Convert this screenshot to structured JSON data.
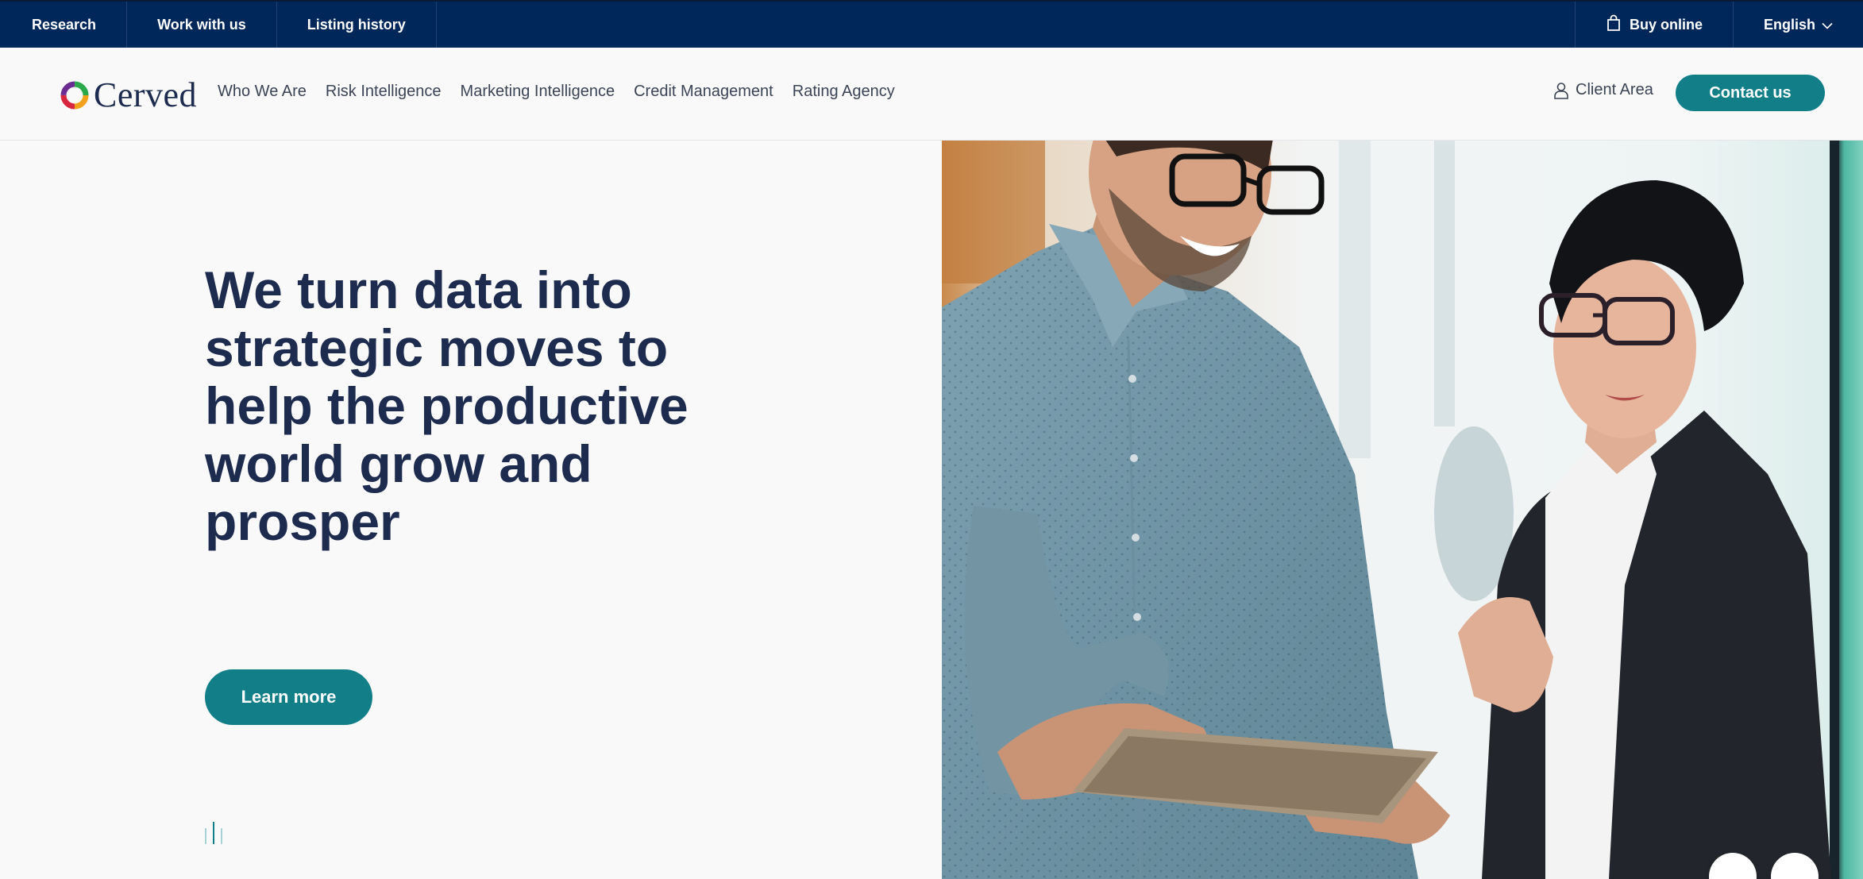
{
  "topbar": {
    "left_items": [
      "Research",
      "Work with us",
      "Listing history"
    ],
    "buy_online": "Buy online",
    "language": "English"
  },
  "nav": {
    "logo_text": "Cerved",
    "links": [
      "Who We Are",
      "Risk Intelligence",
      "Marketing Intelligence",
      "Credit Management",
      "Rating Agency"
    ],
    "client_area": "Client Area",
    "contact_label": "Contact us"
  },
  "hero": {
    "title": "We turn data into strategic moves to help the productive world grow and prosper",
    "cta_label": "Learn more",
    "image_icon": "photo-two-colleagues-with-tablet"
  },
  "colors": {
    "topbar_bg": "#00275a",
    "accent_teal": "#127f88",
    "heading": "#1d2b4f"
  }
}
